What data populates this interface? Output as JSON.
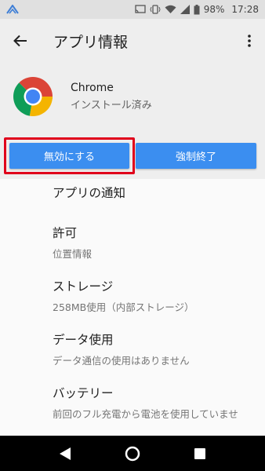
{
  "status_bar": {
    "battery": "98%",
    "time": "17:28",
    "icons": [
      "app-notification-icon",
      "cast-icon",
      "vibrate-icon",
      "wifi-icon",
      "signal-icon",
      "battery-icon"
    ]
  },
  "toolbar": {
    "title": "アプリ情報",
    "back_icon": "arrow-back-icon",
    "menu_icon": "more-vert-icon"
  },
  "app": {
    "name": "Chrome",
    "status": "インストール済み",
    "icon": "chrome-icon"
  },
  "buttons": {
    "disable": "無効にする",
    "force_stop": "強制終了"
  },
  "colors": {
    "button": "#3b8ef0",
    "highlight": "#e0001b",
    "header_bg": "#eeeeee"
  },
  "items": [
    {
      "title": "アプリの通知",
      "subtitle": ""
    },
    {
      "title": "許可",
      "subtitle": "位置情報"
    },
    {
      "title": "ストレージ",
      "subtitle": "258MB使用（内部ストレージ）"
    },
    {
      "title": "データ使用",
      "subtitle": "データ通信の使用はありません"
    },
    {
      "title": "バッテリー",
      "subtitle": "前回のフル充電から電池を使用していませ"
    }
  ],
  "nav": [
    "back-triangle-icon",
    "home-circle-icon",
    "recents-square-icon"
  ]
}
